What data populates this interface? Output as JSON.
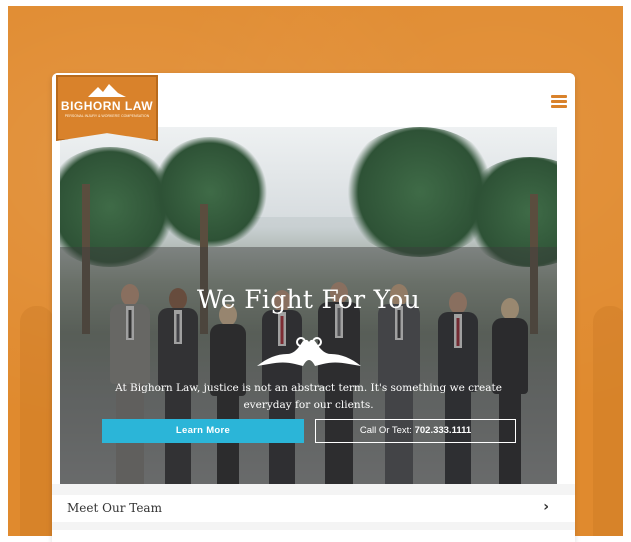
{
  "brand": {
    "name": "BIGHORN LAW",
    "tagline": "PERSONAL INJURY & WORKERS' COMPENSATION",
    "accent_color": "#d9822b",
    "background_color": "#e08a2e"
  },
  "header": {
    "menu_icon": "hamburger-icon"
  },
  "hero": {
    "title": "We Fight For You",
    "emblem_icon": "bighorn-rams-icon",
    "text": "At Bighorn Law, justice is not an abstract term. It's something we create everyday for our clients.",
    "learn_more_label": "Learn More",
    "call_prefix": "Call Or Text: ",
    "call_number": "702.333.1111",
    "button_color": "#2bb5d8"
  },
  "sections": {
    "team_label": "Meet Our Team",
    "team_chevron_icon": "chevron-right-icon"
  }
}
